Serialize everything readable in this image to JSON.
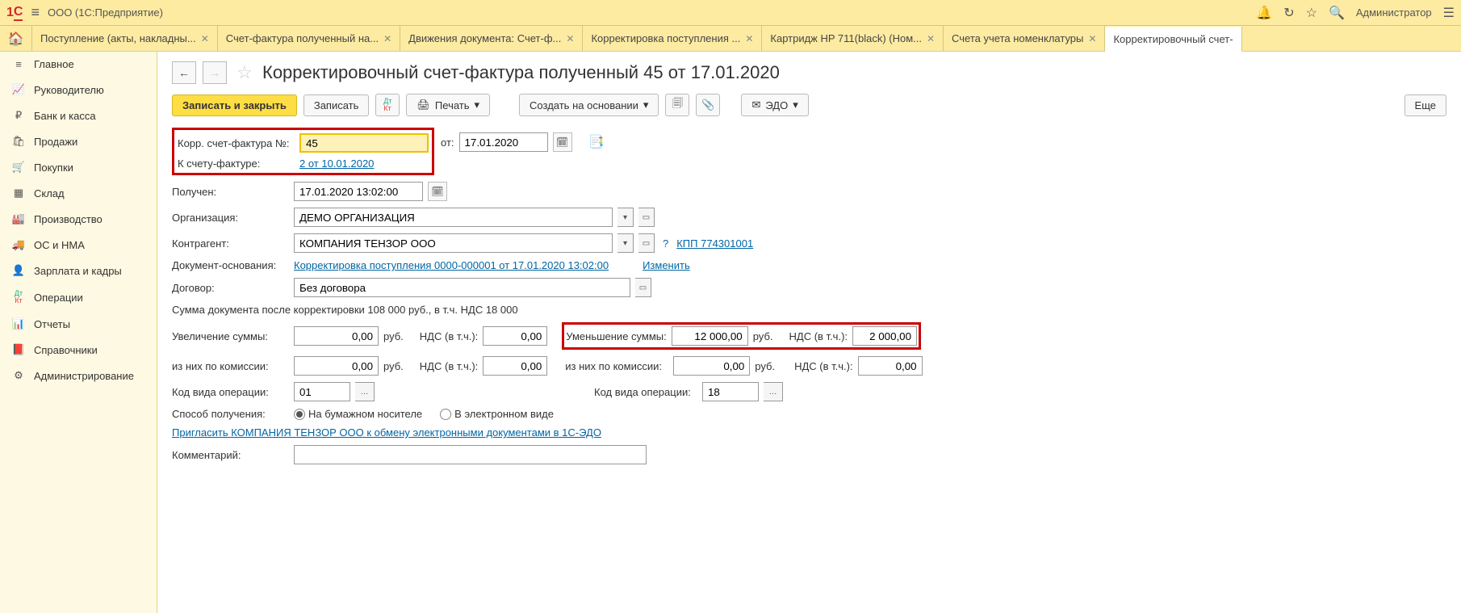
{
  "titlebar": {
    "app": "ООО  (1С:Предприятие)",
    "user": "Администратор"
  },
  "tabs": {
    "t0": "Поступление (акты, накладны...",
    "t1": "Счет-фактура полученный на...",
    "t2": "Движения документа: Счет-ф...",
    "t3": "Корректировка поступления ...",
    "t4": "Картридж HP 711(black) (Ном...",
    "t5": "Счета учета номенклатуры",
    "t6": "Корректировочный счет-"
  },
  "sidebar": {
    "s0": "Главное",
    "s1": "Руководителю",
    "s2": "Банк и касса",
    "s3": "Продажи",
    "s4": "Покупки",
    "s5": "Склад",
    "s6": "Производство",
    "s7": "ОС и НМА",
    "s8": "Зарплата и кадры",
    "s9": "Операции",
    "s10": "Отчеты",
    "s11": "Справочники",
    "s12": "Администрирование"
  },
  "page": {
    "title": "Корректировочный счет-фактура полученный 45 от 17.01.2020"
  },
  "toolbar": {
    "save_close": "Записать и закрыть",
    "save": "Записать",
    "print": "Печать",
    "create": "Создать на основании",
    "edo": "ЭДО",
    "more": "Еще"
  },
  "labels": {
    "korr": "Корр. счет-фактура №:",
    "k_sf": "К счету-фактуре:",
    "ot": "от:",
    "poluchen": "Получен:",
    "org": "Организация:",
    "kontr": "Контрагент:",
    "dok_osn": "Документ-основания:",
    "izmenit": "Изменить",
    "dogovor": "Договор:",
    "summ_doc": "Сумма документа после корректировки 108 000 руб., в т.ч. НДС 18 000",
    "uvel": "Увеличение суммы:",
    "umen": "Уменьшение суммы:",
    "nds": "НДС (в т.ч.):",
    "rub": "руб.",
    "iz_kom": "из них по комиссии:",
    "kod_op": "Код вида операции:",
    "sposob": "Способ получения:",
    "sp1": "На бумажном носителе",
    "sp2": "В электронном виде",
    "invite": "Пригласить КОМПАНИЯ ТЕНЗОР ООО к обмену электронными документами в 1С-ЭДО",
    "komment": "Комментарий:"
  },
  "values": {
    "num": "45",
    "date": "17.01.2020",
    "k_sf_link": "2 от 10.01.2020",
    "poluchen": "17.01.2020 13:02:00",
    "org": "ДЕМО ОРГАНИЗАЦИЯ",
    "kontr": "КОМПАНИЯ ТЕНЗОР ООО",
    "kpp": "КПП 774301001",
    "dok_osn": "Корректировка поступления 0000-000001 от 17.01.2020 13:02:00",
    "dogovor": "Без договора",
    "uvel": "0,00",
    "uvel_nds": "0,00",
    "umen": "12 000,00",
    "umen_nds": "2 000,00",
    "kom1": "0,00",
    "kom1_nds": "0,00",
    "kom2": "0,00",
    "kom2_nds": "0,00",
    "kod1": "01",
    "kod2": "18",
    "komment": ""
  }
}
